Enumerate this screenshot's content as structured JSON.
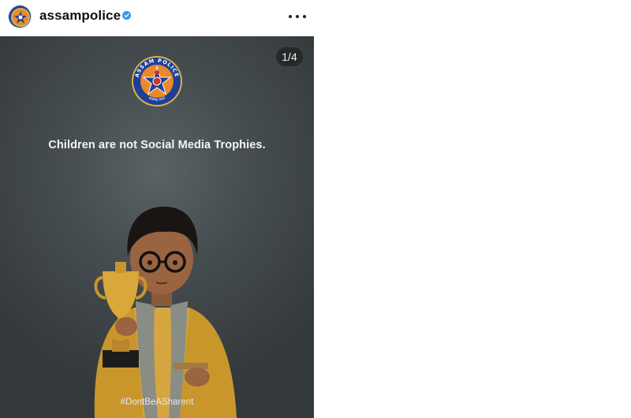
{
  "header": {
    "username": "assampolice",
    "verified_icon": "verified-badge-icon",
    "more_icon": "more-options-icon"
  },
  "post": {
    "counter": "1/4",
    "logo_text_top": "ASSAM POLICE",
    "logo_text_bottom": "सत्यमेव जयते",
    "headline": "Children are not Social Media Trophies.",
    "hashtag": "#DontBeASharent"
  },
  "colors": {
    "verified": "#3797f0",
    "background_dark": "#3c4245",
    "logo_orange": "#e8892a",
    "logo_blue": "#1f3f96",
    "logo_gold": "#d6b34a",
    "kurta_mustard": "#c9962c"
  }
}
